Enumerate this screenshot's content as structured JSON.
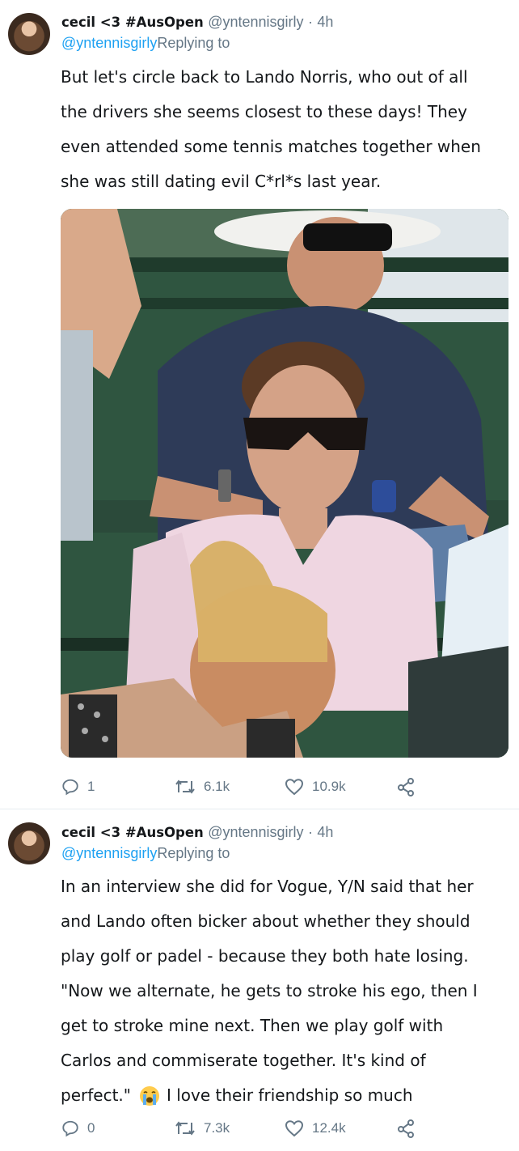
{
  "tweets": [
    {
      "display_name": "cecil <3 #AusOpen",
      "handle": "@yntennisgirly",
      "separator": "·",
      "time": "4h",
      "reply_handle": "@yntennisgirly",
      "reply_label": "Replying to",
      "text_lines": [
        "But let's circle back to Lando Norris, who out of all",
        "the drivers she seems closest to these days! They",
        "even attended some tennis matches together when",
        "she was still dating evil C*rl*s last year."
      ],
      "reply_count": "1",
      "retweet_count": "6.1k",
      "like_count": "10.9k"
    },
    {
      "display_name": "cecil <3 #AusOpen",
      "handle": "@yntennisgirly",
      "separator": "·",
      "time": "4h",
      "reply_handle": "@yntennisgirly",
      "reply_label": "Replying to",
      "text_lines": [
        "In an interview she did for Vogue, Y/N said that her",
        "and Lando often bicker about whether they should",
        "play golf or padel - because they both hate losing.",
        "\"Now we alternate, he gets to stroke his ego, then I",
        "get to stroke mine next. Then we play golf with",
        "Carlos and commiserate together. It's kind of",
        "perfect.\"",
        "I love their friendship so much"
      ],
      "reply_count": "0",
      "retweet_count": "7.3k",
      "like_count": "12.4k"
    }
  ],
  "icons": {
    "reply": "reply-icon",
    "retweet": "retweet-icon",
    "like": "heart-icon",
    "share": "share-icon",
    "emoji": "loudly-crying-face-emoji"
  },
  "colors": {
    "text": "#14171a",
    "muted": "#657786",
    "link": "#1da1f2",
    "divider": "#e6ecf0"
  }
}
